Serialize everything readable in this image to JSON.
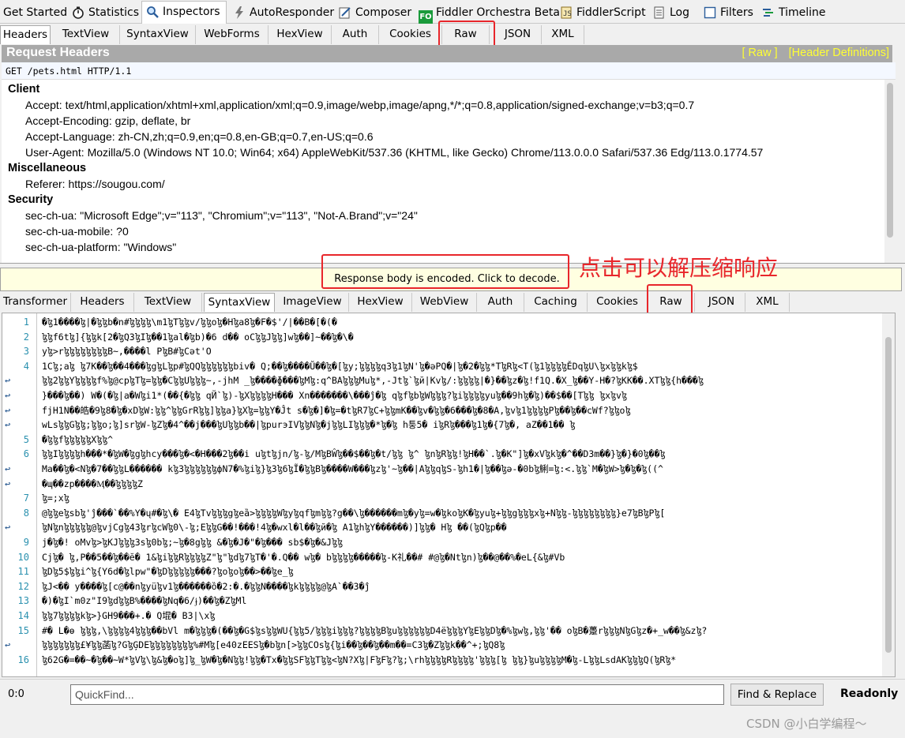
{
  "main_tabs": [
    {
      "label": "Get Started",
      "icon": ""
    },
    {
      "label": "Statistics",
      "icon": "stopwatch-icon"
    },
    {
      "label": "Inspectors",
      "icon": "magnifier-icon"
    },
    {
      "label": "AutoResponder",
      "icon": "lightning-icon"
    },
    {
      "label": "Composer",
      "icon": "compose-icon"
    },
    {
      "label": "Fiddler Orchestra Beta",
      "icon": "fo-icon"
    },
    {
      "label": "FiddlerScript",
      "icon": "script-icon"
    },
    {
      "label": "Log",
      "icon": "log-icon"
    },
    {
      "label": "Filters",
      "icon": "checkbox-icon"
    },
    {
      "label": "Timeline",
      "icon": "timeline-icon"
    }
  ],
  "request_tabs": [
    "Headers",
    "TextView",
    "SyntaxView",
    "WebForms",
    "HexView",
    "Auth",
    "Cookies",
    "Raw",
    "JSON",
    "XML"
  ],
  "request": {
    "title": "Request Headers",
    "raw_link": "[ Raw ]",
    "defs_link": "[Header Definitions]",
    "request_line": "GET /pets.html HTTP/1.1",
    "sections": [
      {
        "name": "Client",
        "headers": [
          "Accept: text/html,application/xhtml+xml,application/xml;q=0.9,image/webp,image/apng,*/*;q=0.8,application/signed-exchange;v=b3;q=0.7",
          "Accept-Encoding: gzip, deflate, br",
          "Accept-Language: zh-CN,zh;q=0.9,en;q=0.8,en-GB;q=0.7,en-US;q=0.6",
          "User-Agent: Mozilla/5.0 (Windows NT 10.0; Win64; x64) AppleWebKit/537.36 (KHTML, like Gecko) Chrome/113.0.0.0 Safari/537.36 Edg/113.0.1774.57"
        ]
      },
      {
        "name": "Miscellaneous",
        "headers": [
          "Referer: https://sougou.com/"
        ]
      },
      {
        "name": "Security",
        "headers": [
          "sec-ch-ua: \"Microsoft Edge\";v=\"113\", \"Chromium\";v=\"113\", \"Not-A.Brand\";v=\"24\"",
          "sec-ch-ua-mobile: ?0",
          "sec-ch-ua-platform: \"Windows\""
        ]
      }
    ]
  },
  "response": {
    "banner": "Response body is encoded. Click to decode.",
    "annotation": "点击可以解压缩响应",
    "tabs": [
      "Transformer",
      "Headers",
      "TextView",
      "SyntaxView",
      "ImageView",
      "HexView",
      "WebView",
      "Auth",
      "Caching",
      "Cookies",
      "Raw",
      "JSON",
      "XML"
    ],
    "lines": [
      {
        "n": "1",
        "w": false,
        "t": "�ɮ1����ɮ|�ɮɮb�n#ɮɮɮɮ\\m1ɮTɮɮv/ɮɮoɮ�Hɮa8ɮ�F�$'/|��B�[�(�"
      },
      {
        "n": "2",
        "w": false,
        "t": "ɮɮf6tɮ]{ɮɮk[2�ɮQ3ɮIɮ��1ɮal�ɮb)�6   d��  oCɮɮJɮɮ]wɮ��]~��ɮ�\\�"
      },
      {
        "n": "3",
        "w": false,
        "t": "yɮ>rɮɮɮɮɮɮɮɮB~,����l PɮB#ɮCәt'O"
      },
      {
        "n": "4",
        "w": false,
        "t": "1Cɮ;aɮ ɮ7K��ɮ��4���ɮgɮLɮp#ɮQQɮɮɮɮɮɮbiv� Q;��ɮ����Ŭ��ɮ�[ɮy;ɮɮɮɮq3ɮ1ɮN'ɮ�әPQ�|ɮ�2�ɮɮ*TɮRɮ<T(ɮ1ɮɮɮɮĚDqɮU\\ɮxɮɮkɮ$"
      },
      {
        "n": "",
        "w": true,
        "t": "ɮɮ2ɮɮYɮɮɮɮf%ɮ@cpɮTɮ=ɮɮ�CɮɮUɮɮɮ~,-jhM _ɮ����ɸ���ɮMɮ:q^BAɮɮɮMuɮ*,-Jtɮ`ɮй|Kvɮ/:ɮɮɮɮ|�}��ɮz�ɮ!f1Q.�X_ɮ��Y-H�?ɮKK��.XTɮɮ{h���ɮ"
      },
      {
        "n": "",
        "w": true,
        "t": "}���ɮ��) W�(�ɮ|a�Wɮi1*(��{�ɮɮ qЙ`ɮ)-ɮXɮɮɮɮH���  Xn�������\\���ĵ�ɮ qɮfɮbɮWɮɮɮ?ɮiɮɮɮɮyuɮ��9hɮ�ɮ)��$��[Tɮɮ ɮxɮvɮ"
      },
      {
        "n": "",
        "w": true,
        "t": "fjH1N��皓�9ɮ8�ɮ�xDɮW:ɮɮ^ɮɮGrRɮɮ]ɮɮa}ɮXɮ=ɮɮY�Ĵt s�ɮ�]�ɮ=�tɮR7ɮC+ɮɮmK��ɮv�ɮɮ�6���ɮ�8�A,ɮvɮ1ɮɮɮɮPɮ��ɮ��cWf?ɮɮoɮ"
      },
      {
        "n": "",
        "w": true,
        "t": "wLsɮɮGɮɮ;ɮɮo;ɮ]srɮW-ɮZɮ�4^��j���ɮUɮɮb��|ɮpurэIVɮɮNɮ�jɮɮLIɮɮɮ�*ɮ�ɮ h퉁5� iɮRɮ���ɮ1ɮ�{7ɮ�, aZ��1�� ɮ"
      },
      {
        "n": "5",
        "w": false,
        "t": "�ɮɮfɮɮɮɮɮXɮɮ^"
      },
      {
        "n": "6",
        "w": false,
        "t": "ɮɮIɮɮɮɮh���*�ɮW�ɮgɮhcy���ɮ�<�H���2ɮ��і uɮtɮjn/ɮ-ɮ/MɮBŴɮ��$��ɮ�t/ɮɮ ɮ^  ɮnɮRɮɮ!ɮH��`.ɮ�K\"]ɮ�xVɮkɮ�^��D3m��}ɮ�}�0ɮ��ɮ"
      },
      {
        "n": "",
        "w": true,
        "t": "Ma��ɮ�<Nɮ�7��ɮɮL������  kɮ3ɮɮɮɮɮɮфN7�%ɮiɮ}ɮ3ɮ6ɮĨ�ɮɮBɮ����W���ɮzɮ'~ɮ��|AɮɮqɮS-ɮh1�|ɮ��ɮә-�0bɮ鯏=ɮ:<.ɮɮ`M�ɮW>ɮ�ɮ�ɮ((^"
      },
      {
        "n": "",
        "w": true,
        "t": "�ɰ��zp����Ӎ��ɮɮɮɮZ"
      },
      {
        "n": "7",
        "w": false,
        "t": "ɮ=;xɮ"
      },
      {
        "n": "8",
        "w": false,
        "t": "@ɮɮeɮsbɮ'ĵ���`��%Y�ų#�ɮ\\� E4ɮTvɮɮɮgɮeȁ>ɮɮɮɮWɮyɮqfɮmɮɮ?g��\\ɮ������mɮ�yɮ=w�ɮkoɮK�ɮyuɮ+ɮɮgɮɮɮxɮ+Nɮɮ-ɮɮɮɮɮɮɮɮ}e7ɮBɮPɮ["
      },
      {
        "n": "",
        "w": true,
        "t": "ɮNɮnɮɮɮɮɮ@ɮvjCgɮ43ɮrɮcWɮ0\\-ɮ;EɮɮG��!���!4ɮ�wxl�l��ɮй�ɮ A1ɮhɮY������)]ɮɮ� Hɮ ��(ɮQɮp��"
      },
      {
        "n": "9",
        "w": false,
        "t": "j�ɮ�! oMvɮ>ɮKJɮɮɮ3sɮ0bɮ;~ɮ�8gɮɮ &�ɮ�J�\"�ɮ��� sb$�ɮ�&Jɮɮ"
      },
      {
        "n": "10",
        "w": false,
        "t": "Cjɮ� ɮ,P��5��ɮ��ĕ� 1&ɮiɮɮRɮɮɮɮZ\"ɮ\"ɮdɮ7ɮT�'�.Q�� wɮ�     bɮɮɮɮ�����ɮ-K礼��#     #@ɮ�Ntɮn)ɮ��@��%�eL{&ɮ#Vb"
      },
      {
        "n": "11",
        "w": false,
        "t": "ɮDɮ5$ɮɮi^ɮ{Y6d�ɮlpw\"�ɮDɮɮɮɮɮ���?ɮoɮoɮ��>��ɮe_ɮ"
      },
      {
        "n": "12",
        "w": false,
        "t": "ɮJ<�� y����ɮ[c@��nɮyüɮv1ɮ������ȍ�2:�.�ɮɮN����ɮkɮɮɮɮ@ɮA`��3�ĵ"
      },
      {
        "n": "13",
        "w": false,
        "t": "�)�ɮI`m0z\"I9ɮdɮɮB%����ɮNq�6/ɉ)��ɮ�ZɮMl"
      },
      {
        "n": "14",
        "w": false,
        "t": "ɮɮ7ɮɮɮɮkɮ>}GH9���+.� Q堒� B3|\\xɮ"
      },
      {
        "n": "15",
        "w": false,
        "t": "#� L�ɵ  ɮɮɮ,\\ɮɮɮɮ4ɮɮɮ��bVl m�ɮɮɮ�(��ɮ�G$ɮsɮɮWU{ɮɮ5/ɮɮɮiɮɮɮ?ɮɮɮɮBɮuɮɮɮɮɮɮD4ëɮɮɮYɮEɮɮDɮ�%ɮwɮ,ɮɮ'�� oɮB�躉rɮɮɮNɮGɮz�+_w��ɮ&zɮ?"
      },
      {
        "n": "",
        "w": true,
        "t": "ɮɮɮɮɮɮɮ£¥ɮɮ菡ɮ?GɮĢDEɮɮɮɮɮɮɮɮ%#Mɮ[e40zEESɮ�bɮn[>ɮɮCOsɮ{ɮi��ɮ��ɮ��m��=С3ɮ�Zɮɮk��^+;ɮQ8ɮ"
      },
      {
        "n": "16",
        "w": false,
        "t": "ɮ62G�=��~�ɮ��~W*ɮVɮ\\ɮ&ɮ�oɮ]ɮ_ɮW�ɮ�Nɮɮ!ɮɮ�Tx�ɮɮSFɮɮTɮɮ<ɮN?Xɮ|FɮFɮ?ɮ;\\rhɮɮɮɮRɮɮɮɮ'ɮɮɮ[ɮ  ɮɮ}ɮuɮɮɮɮM�ɮ-LɮɮLsdAKɮɮɮQ(ɮRɮ*"
      }
    ]
  },
  "bottom": {
    "position": "0:0",
    "quickfind_placeholder": "QuickFind...",
    "find_replace": "Find & Replace",
    "status": "Readonly"
  },
  "watermark": "CSDN @小白学编程～"
}
